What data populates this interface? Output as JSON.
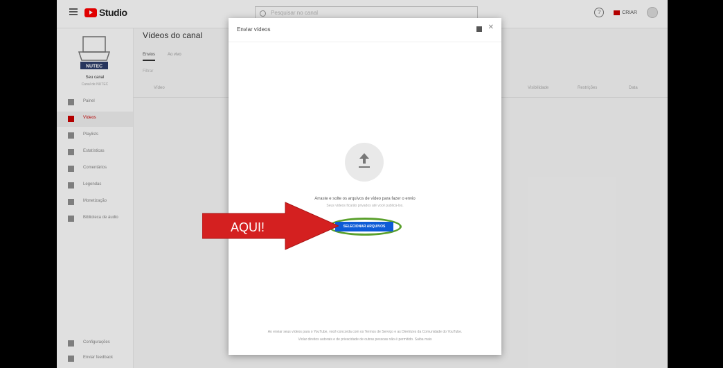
{
  "app": {
    "title": "Studio"
  },
  "search": {
    "placeholder": "Pesquisar no canal"
  },
  "header": {
    "create_label": "CRIAR"
  },
  "sidebar": {
    "channel_name": "Seu canal",
    "channel_sub": "Canal de NUTEC",
    "logo_text": "NUTEC",
    "items": [
      {
        "label": "Painel"
      },
      {
        "label": "Vídeos"
      },
      {
        "label": "Playlists"
      },
      {
        "label": "Estatísticas"
      },
      {
        "label": "Comentários"
      },
      {
        "label": "Legendas"
      },
      {
        "label": "Monetização"
      },
      {
        "label": "Biblioteca de áudio"
      }
    ],
    "bottom_items": [
      {
        "label": "Configurações"
      },
      {
        "label": "Enviar feedback"
      }
    ]
  },
  "main": {
    "title": "Vídeos do canal",
    "tabs": [
      {
        "label": "Envios"
      },
      {
        "label": "Ao vivo"
      }
    ],
    "filter_label": "Filtrar",
    "columns": [
      "Vídeo",
      "Visibilidade",
      "Restrições",
      "Data"
    ]
  },
  "modal": {
    "title": "Enviar vídeos",
    "drag_text": "Arraste e solte os arquivos de vídeo para fazer o envio",
    "drag_subtext": "Seus vídeos ficarão privados até você publicá-los.",
    "select_button": "SELECIONAR ARQUIVOS",
    "footer_line1": "Ao enviar seus vídeos para o YouTube, você concorda com os Termos de Serviço e as Diretrizes da Comunidade do YouTube.",
    "footer_line2": "Violar direitos autorais e de privacidade de outras pessoas não é permitido. Saiba mais"
  },
  "callout": {
    "label": "AQUI!",
    "arrow_color": "#d42020",
    "ring_color": "#5aa02c"
  },
  "colors": {
    "accent": "#cc0000",
    "button_blue": "#0d5bd6"
  }
}
